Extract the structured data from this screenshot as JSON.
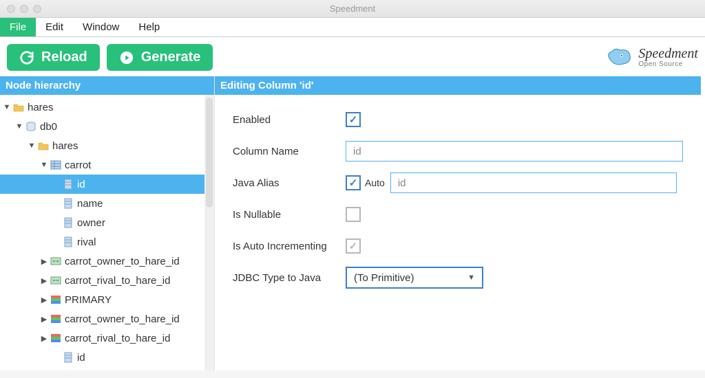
{
  "window": {
    "title": "Speedment"
  },
  "menu": {
    "items": [
      "File",
      "Edit",
      "Window",
      "Help"
    ],
    "active_index": 0
  },
  "toolbar": {
    "reload": "Reload",
    "generate": "Generate"
  },
  "logo": {
    "name": "Speedment",
    "sub": "Open Source"
  },
  "tree": {
    "title": "Node hierarchy",
    "rows": [
      {
        "label": "hares",
        "indent": 0,
        "arrow": "down",
        "icon": "folder",
        "selected": false
      },
      {
        "label": "db0",
        "indent": 1,
        "arrow": "down",
        "icon": "db",
        "selected": false
      },
      {
        "label": "hares",
        "indent": 2,
        "arrow": "down",
        "icon": "folder",
        "selected": false
      },
      {
        "label": "carrot",
        "indent": 3,
        "arrow": "down",
        "icon": "table",
        "selected": false
      },
      {
        "label": "id",
        "indent": 4,
        "arrow": "",
        "icon": "col",
        "selected": true
      },
      {
        "label": "name",
        "indent": 4,
        "arrow": "",
        "icon": "col",
        "selected": false
      },
      {
        "label": "owner",
        "indent": 4,
        "arrow": "",
        "icon": "col",
        "selected": false
      },
      {
        "label": "rival",
        "indent": 4,
        "arrow": "",
        "icon": "col",
        "selected": false
      },
      {
        "label": "carrot_owner_to_hare_id",
        "indent": 3,
        "arrow": "right",
        "icon": "fk",
        "selected": false
      },
      {
        "label": "carrot_rival_to_hare_id",
        "indent": 3,
        "arrow": "right",
        "icon": "fk",
        "selected": false
      },
      {
        "label": "PRIMARY",
        "indent": 3,
        "arrow": "right",
        "icon": "pk",
        "selected": false
      },
      {
        "label": "carrot_owner_to_hare_id",
        "indent": 3,
        "arrow": "right",
        "icon": "pk",
        "selected": false
      },
      {
        "label": "carrot_rival_to_hare_id",
        "indent": 3,
        "arrow": "right",
        "icon": "pk",
        "selected": false
      },
      {
        "label": "id",
        "indent": 4,
        "arrow": "",
        "icon": "col",
        "selected": false
      }
    ]
  },
  "editor": {
    "title": "Editing Column 'id'",
    "enabled_label": "Enabled",
    "enabled_checked": true,
    "column_name_label": "Column Name",
    "column_name_value": "id",
    "java_alias_label": "Java Alias",
    "java_alias_auto_checked": true,
    "java_alias_auto_label": "Auto",
    "java_alias_value": "id",
    "nullable_label": "Is Nullable",
    "nullable_checked": false,
    "autoinc_label": "Is Auto Incrementing",
    "autoinc_checked": true,
    "jdbc_label": "JDBC Type to Java",
    "jdbc_value": "(To Primitive)"
  }
}
